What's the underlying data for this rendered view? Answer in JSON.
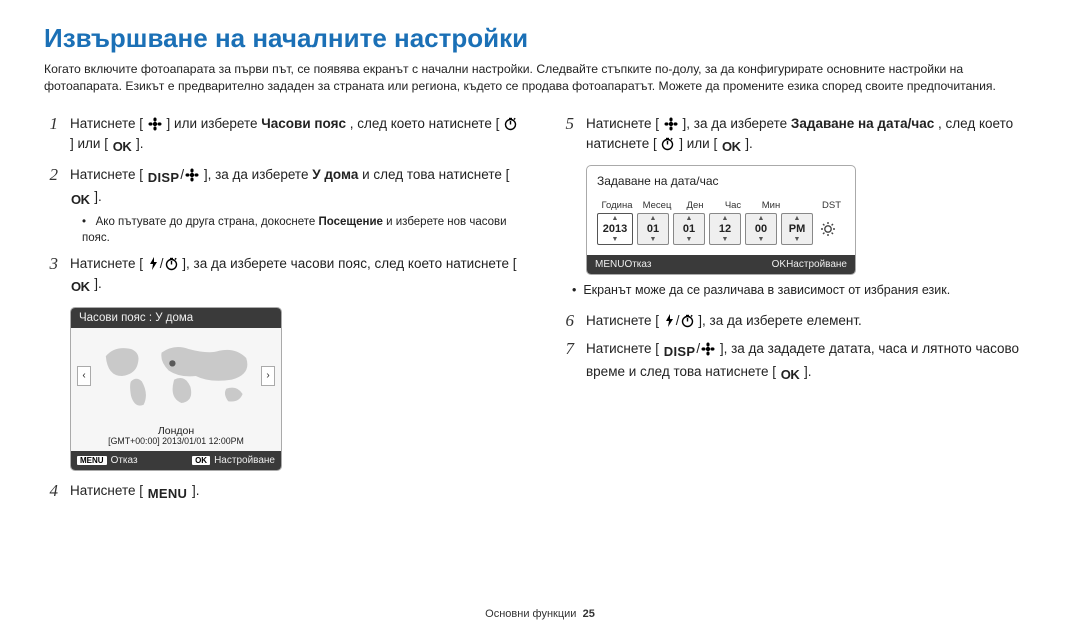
{
  "title": "Извършване на началните настройки",
  "intro": "Когато включите фотоапарата за първи път, се появява екранът с начални настройки. Следвайте стъпките по-долу, за да конфигурирате основните настройки на фотоапаратa. Езикът е предварително зададен за страната или региона, където се продава фотоапаратът. Можете да промените езика според своите предпочитания.",
  "steps": {
    "s1_a": "Натиснете [",
    "s1_b": "] или изберете ",
    "s1_c": "Часови пояс",
    "s1_d": ", след което натиснете [",
    "s1_e": "] или [",
    "s1_f": "].",
    "s2_a": "Натиснете [",
    "s2_b": "], за да изберете ",
    "s2_c": "У дома",
    "s2_d": " и след това натиснете [",
    "s2_e": "].",
    "s2_sub_a": "Ако пътувате до друга страна, докоснете ",
    "s2_sub_b": "Посещение",
    "s2_sub_c": " и изберете нов часови пояс.",
    "s3_a": "Натиснете [",
    "s3_b": "], за да изберете часови пояс, след което натиснете [",
    "s3_c": "].",
    "s4": "Натиснете [",
    "s4_b": "].",
    "s5_a": "Натиснете [",
    "s5_b": "], за да изберете ",
    "s5_c": "Задаване на дата/час",
    "s5_d": ", след което натиснете [",
    "s5_e": "] или [",
    "s5_f": "].",
    "s5_note": "Екранът може да се различава в зависимост от избрания език.",
    "s6_a": "Натиснете [",
    "s6_b": "], за да изберете елемент.",
    "s7_a": "Натиснете [",
    "s7_b": "], за да зададете датата, часа и лятното часово време и след това натиснете [",
    "s7_c": "]."
  },
  "tokens": {
    "disp": "DISP",
    "menu": "MENU",
    "ok": "OK"
  },
  "map_card": {
    "header": "Часови пояс : У дома",
    "city": "Лондон",
    "gmt": "[GMT+00:00] 2013/01/01 12:00PM",
    "cancel": "Отказ",
    "set": "Настройване"
  },
  "dt_card": {
    "title": "Задаване на дата/час",
    "labels": {
      "year": "Година",
      "month": "Месец",
      "day": "Ден",
      "hour": "Час",
      "min": "Мин",
      "dst": "DST"
    },
    "vals": {
      "year": "2013",
      "month": "01",
      "day": "01",
      "hour": "12",
      "min": "00",
      "ampm": "PM"
    },
    "cancel": "Отказ",
    "set": "Настройване"
  },
  "footer": {
    "label": "Основни функции",
    "page": "25"
  }
}
